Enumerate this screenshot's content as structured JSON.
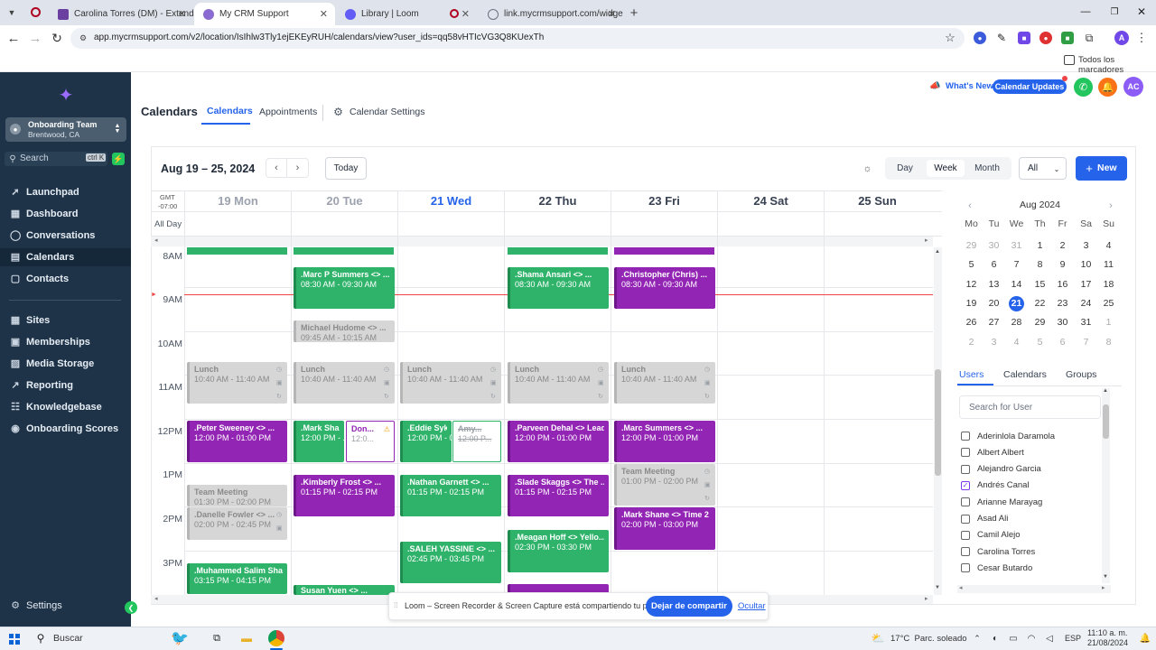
{
  "browser": {
    "tabs": [
      {
        "label": "Carolina Torres (DM) - Extendly",
        "color": "#6b3fa0"
      },
      {
        "label": "My CRM Support",
        "color": "#8a6bd1"
      },
      {
        "label": "Library | Loom",
        "color": "#625df5"
      },
      {
        "label": "link.mycrmsupport.com/widget",
        "color": "#6b7280"
      }
    ],
    "url": "app.mycrmsupport.com/v2/location/IsIhlw3Tly1ejEKEyRUH/calendars/view?user_ids=qq58vHTIcVG3Q8KUexTh",
    "bookmarks_label": "Todos los marcadores",
    "profile_initial": "A"
  },
  "sidebar": {
    "account_name": "Onboarding Team",
    "account_location": "Brentwood, CA",
    "search_placeholder": "Search",
    "search_shortcut": "ctrl K",
    "items": [
      {
        "label": "Launchpad",
        "icon": "rocket-icon"
      },
      {
        "label": "Dashboard",
        "icon": "dashboard-icon"
      },
      {
        "label": "Conversations",
        "icon": "chat-icon"
      },
      {
        "label": "Calendars",
        "icon": "calendar-icon"
      },
      {
        "label": "Contacts",
        "icon": "contacts-icon"
      },
      {
        "label": "Sites",
        "icon": "sites-icon"
      },
      {
        "label": "Memberships",
        "icon": "memberships-icon"
      },
      {
        "label": "Media Storage",
        "icon": "media-icon"
      },
      {
        "label": "Reporting",
        "icon": "reporting-icon"
      },
      {
        "label": "Knowledgebase",
        "icon": "knowledge-icon"
      },
      {
        "label": "Onboarding Scores",
        "icon": "scores-icon"
      }
    ],
    "settings_label": "Settings"
  },
  "header": {
    "page_title": "Calendars",
    "tabs": [
      "Calendars",
      "Appointments",
      "Calendar Settings"
    ],
    "whats_new": "What's New",
    "calendar_updates": "Calendar Updates",
    "avatar_initials": "AC"
  },
  "toolbar": {
    "range": "Aug 19 – 25, 2024",
    "today": "Today",
    "views": [
      "Day",
      "Week",
      "Month"
    ],
    "filter": "All",
    "new_button": "New"
  },
  "grid": {
    "tz": "GMT",
    "tz_offset": "-07:00",
    "all_day": "All Day",
    "days": [
      "19 Mon",
      "20 Tue",
      "21 Wed",
      "22 Thu",
      "23 Fri",
      "24 Sat",
      "25 Sun"
    ],
    "hours": [
      "8AM",
      "9AM",
      "10AM",
      "11AM",
      "12PM",
      "1PM",
      "2PM",
      "3PM"
    ]
  },
  "events": [
    {
      "title": ".Marc P Summers <> ...",
      "time": "08:30 AM - 09:30 AM"
    },
    {
      "title": ".Shama Ansari <> ...",
      "time": "08:30 AM - 09:30 AM"
    },
    {
      "title": ".Christopher (Chris) ...",
      "time": "08:30 AM - 09:30 AM"
    },
    {
      "title": "Michael Hudome <> ...",
      "time": "09:45 AM - 10:15 AM"
    },
    {
      "title": "Lunch",
      "time": "10:40 AM - 11:40 AM"
    },
    {
      "title": ".Peter Sweeney <> ...",
      "time": "12:00 PM - 01:00 PM"
    },
    {
      "title": ".Mark Shane...",
      "time": "12:00 PM - ..."
    },
    {
      "title": "Don...",
      "time": "12:0..."
    },
    {
      "title": ".Eddie Sykes...",
      "time": "12:00 PM - 0..."
    },
    {
      "title": "Amy...",
      "time": "12:00 P..."
    },
    {
      "title": ".Parveen Dehal <> Lead...",
      "time": "12:00 PM - 01:00 PM"
    },
    {
      "title": ".Marc Summers <> ...",
      "time": "12:00 PM - 01:00 PM"
    },
    {
      "title": "Team Meeting",
      "time": "01:00 PM - 02:00 PM"
    },
    {
      "title": ".Kimberly Frost <> ...",
      "time": "01:15 PM - 02:15 PM"
    },
    {
      "title": ".Nathan Garnett <> ...",
      "time": "01:15 PM - 02:15 PM"
    },
    {
      "title": ".Slade Skaggs <> The ...",
      "time": "01:15 PM - 02:15 PM"
    },
    {
      "title": "Team Meeting",
      "time": "01:30 PM - 02:00 PM"
    },
    {
      "title": ".Danelle Fowler <> ...",
      "time": "02:00 PM - 02:45 PM"
    },
    {
      "title": ".Mark Shane <> Time 2 ...",
      "time": "02:00 PM - 03:00 PM"
    },
    {
      "title": ".Meagan Hoff <> Yello...",
      "time": "02:30 PM - 03:30 PM"
    },
    {
      "title": ".SALEH YASSINE <> ...",
      "time": "02:45 PM - 03:45 PM"
    },
    {
      "title": ".Muhammed Salim Shar...",
      "time": "03:15 PM - 04:15 PM"
    },
    {
      "title": "Susan Yuen <> ...",
      "time": ""
    }
  ],
  "mini_calendar": {
    "month": "Aug 2024",
    "weekdays": [
      "Mo",
      "Tu",
      "We",
      "Th",
      "Fr",
      "Sa",
      "Su"
    ],
    "weeks": [
      [
        "29",
        "30",
        "31",
        "1",
        "2",
        "3",
        "4"
      ],
      [
        "5",
        "6",
        "7",
        "8",
        "9",
        "10",
        "11"
      ],
      [
        "12",
        "13",
        "14",
        "15",
        "16",
        "17",
        "18"
      ],
      [
        "19",
        "20",
        "21",
        "22",
        "23",
        "24",
        "25"
      ],
      [
        "26",
        "27",
        "28",
        "29",
        "30",
        "31",
        "1"
      ],
      [
        "2",
        "3",
        "4",
        "5",
        "6",
        "7",
        "8"
      ]
    ],
    "selected": "21"
  },
  "users_panel": {
    "tabs": [
      "Users",
      "Calendars",
      "Groups"
    ],
    "search_placeholder": "Search for User",
    "users": [
      {
        "name": "Aderinlola Daramola",
        "checked": false
      },
      {
        "name": "Albert Albert",
        "checked": false
      },
      {
        "name": "Alejandro Garcia",
        "checked": false
      },
      {
        "name": "Andrés Canal",
        "checked": true
      },
      {
        "name": "Arianne Marayag",
        "checked": false
      },
      {
        "name": "Asad Ali",
        "checked": false
      },
      {
        "name": "Camil Alejo",
        "checked": false
      },
      {
        "name": "Carolina Torres",
        "checked": false
      },
      {
        "name": "Cesar Butardo",
        "checked": false
      }
    ]
  },
  "loom_bar": {
    "message": "Loom – Screen Recorder & Screen Capture está compartiendo tu pantalla.",
    "stop": "Dejar de compartir",
    "hide": "Ocultar"
  },
  "taskbar": {
    "search": "Buscar",
    "weather": "17°C  Parc. soleado",
    "lang": "ESP",
    "time": "11:10 a. m.",
    "date": "21/08/2024"
  }
}
